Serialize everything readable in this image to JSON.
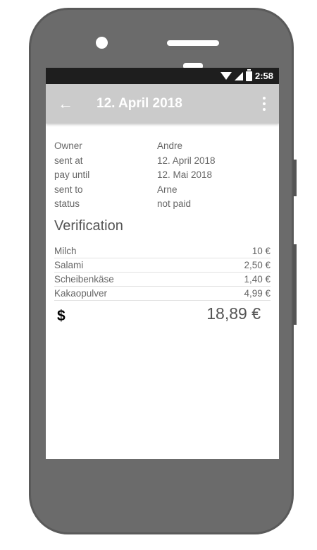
{
  "status_bar": {
    "time": "2:58"
  },
  "app_bar": {
    "title": "12. April 2018"
  },
  "details": [
    {
      "label": "Owner",
      "value": "Andre"
    },
    {
      "label": "sent at",
      "value": "12. April 2018"
    },
    {
      "label": "pay until",
      "value": "12. Mai 2018"
    },
    {
      "label": "sent to",
      "value": "Arne"
    },
    {
      "label": "status",
      "value": "not paid"
    }
  ],
  "verification": {
    "title": "Verification",
    "items": [
      {
        "name": "Milch",
        "price": "10 €"
      },
      {
        "name": "Salami",
        "price": "2,50 €"
      },
      {
        "name": "Scheibenkäse",
        "price": "1,40 €"
      },
      {
        "name": "Kakaopulver",
        "price": "4,99 €"
      }
    ],
    "total": {
      "currency_icon": "$",
      "amount": "18,89 €"
    }
  },
  "icons": {
    "back": "arrow-left",
    "more": "vertical-dots",
    "wifi": "wifi",
    "signal": "cell-signal",
    "battery": "battery"
  }
}
